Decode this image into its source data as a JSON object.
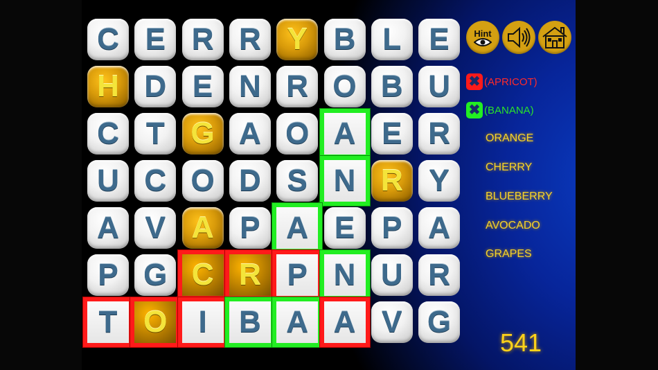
{
  "grid": {
    "rows": [
      [
        "C",
        "E",
        "R",
        "R",
        "Y",
        "B",
        "L",
        "E"
      ],
      [
        "H",
        "D",
        "E",
        "N",
        "R",
        "O",
        "B",
        "U"
      ],
      [
        "C",
        "T",
        "G",
        "A",
        "O",
        "A",
        "E",
        "R"
      ],
      [
        "U",
        "C",
        "O",
        "D",
        "S",
        "N",
        "R",
        "Y"
      ],
      [
        "A",
        "V",
        "A",
        "P",
        "A",
        "E",
        "P",
        "A"
      ],
      [
        "P",
        "G",
        "C",
        "R",
        "P",
        "N",
        "U",
        "R"
      ],
      [
        "T",
        "O",
        "I",
        "B",
        "A",
        "A",
        "V",
        "G"
      ]
    ],
    "hint_cells": [
      [
        0,
        4
      ],
      [
        1,
        0
      ],
      [
        2,
        2
      ],
      [
        3,
        6
      ],
      [
        4,
        2
      ],
      [
        5,
        2
      ],
      [
        5,
        3
      ],
      [
        6,
        1
      ]
    ],
    "paths": [
      {
        "word": "APRICOT",
        "color": "#ff1a1a",
        "cells": [
          [
            6,
            5
          ],
          [
            5,
            4
          ],
          [
            5,
            3
          ],
          [
            6,
            2
          ],
          [
            5,
            2
          ],
          [
            6,
            1
          ],
          [
            6,
            0
          ]
        ]
      },
      {
        "word": "BANANA",
        "color": "#22ee22",
        "cells": [
          [
            6,
            3
          ],
          [
            6,
            4
          ],
          [
            5,
            5
          ],
          [
            4,
            4
          ],
          [
            3,
            5
          ],
          [
            2,
            5
          ]
        ]
      }
    ]
  },
  "toolbar": {
    "hint_label": "Hint",
    "hint_icon": "eye-icon",
    "sound_icon": "speaker-icon",
    "home_icon": "house-icon"
  },
  "words": {
    "found": [
      {
        "label": "(APRICOT)",
        "status": "wrong",
        "color": "#ff1a1a"
      },
      {
        "label": "(BANANA)",
        "status": "found",
        "color": "#22ee22"
      }
    ],
    "remaining": [
      "ORANGE",
      "CHERRY",
      "BLUEBERRY",
      "AVOCADO",
      "GRAPES"
    ],
    "x_glyph": "✖"
  },
  "score": "541"
}
